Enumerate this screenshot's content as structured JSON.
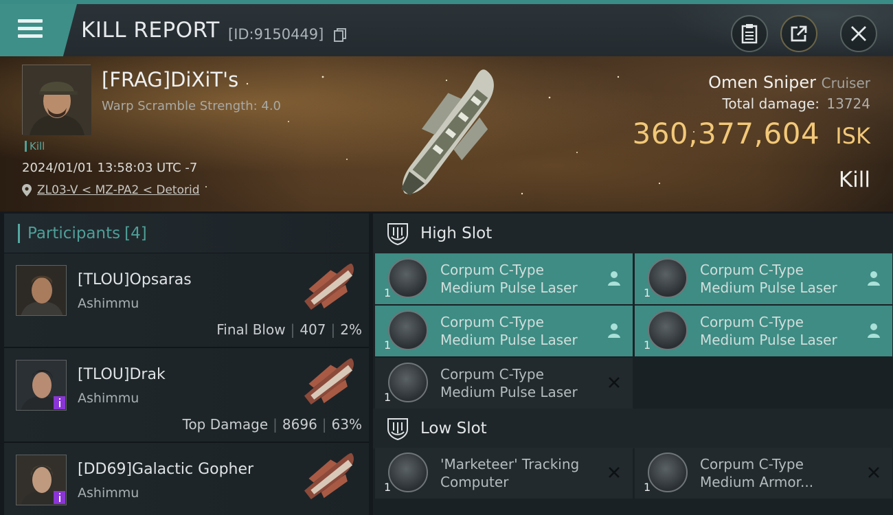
{
  "header": {
    "title": "KILL REPORT",
    "report_id": "[ID:9150449]",
    "icons": [
      "menu-icon",
      "copy-icon",
      "clipboard-icon",
      "share-icon",
      "close-icon"
    ]
  },
  "victim": {
    "name": "[FRAG]DiXiT's",
    "warp_scramble": "Warp Scramble Strength: 4.0",
    "tag": "Kill",
    "datetime": "2024/01/01 13:58:03 UTC -7",
    "location": "ZL03-V < MZ-PA2 < Detorid",
    "ship_name": "Omen Sniper",
    "ship_class": "Cruiser",
    "total_damage_label": "Total damage:",
    "total_damage": "13724",
    "isk_value": "360,377,604",
    "isk_unit": "ISK",
    "outcome": "Kill"
  },
  "participants": {
    "label": "Participants",
    "count": "[4]",
    "rows": [
      {
        "name": "[TLOU]Opsaras",
        "ship": "Ashimmu",
        "role": "Final Blow",
        "damage": "407",
        "percent": "2%",
        "badge": false
      },
      {
        "name": "[TLOU]Drak",
        "ship": "Ashimmu",
        "role": "Top Damage",
        "damage": "8696",
        "percent": "63%",
        "badge": true
      },
      {
        "name": "[DD69]Galactic Gopher",
        "ship": "Ashimmu",
        "role": "",
        "damage": "",
        "percent": "",
        "badge": true
      }
    ]
  },
  "fitting": {
    "high_slot_label": "High Slot",
    "low_slot_label": "Low Slot",
    "high_modules": [
      {
        "line1": "Corpum C-Type",
        "line2": "Medium Pulse Laser",
        "qty": "1",
        "status": "dropped"
      },
      {
        "line1": "Corpum C-Type",
        "line2": "Medium Pulse Laser",
        "qty": "1",
        "status": "dropped"
      },
      {
        "line1": "Corpum C-Type",
        "line2": "Medium Pulse Laser",
        "qty": "1",
        "status": "dropped"
      },
      {
        "line1": "Corpum C-Type",
        "line2": "Medium Pulse Laser",
        "qty": "1",
        "status": "dropped"
      },
      {
        "line1": "Corpum C-Type",
        "line2": "Medium Pulse Laser",
        "qty": "1",
        "status": "destroyed"
      }
    ],
    "low_modules": [
      {
        "line1": "'Marketeer' Tracking",
        "line2": "Computer",
        "qty": "1",
        "status": "destroyed"
      },
      {
        "line1": "Corpum C-Type",
        "line2": "Medium Armor...",
        "qty": "1",
        "status": "destroyed"
      }
    ]
  },
  "colors": {
    "accent_teal": "#3e8c84",
    "isk_gold": "#f2c878",
    "badge_purple": "#8b35d6"
  }
}
